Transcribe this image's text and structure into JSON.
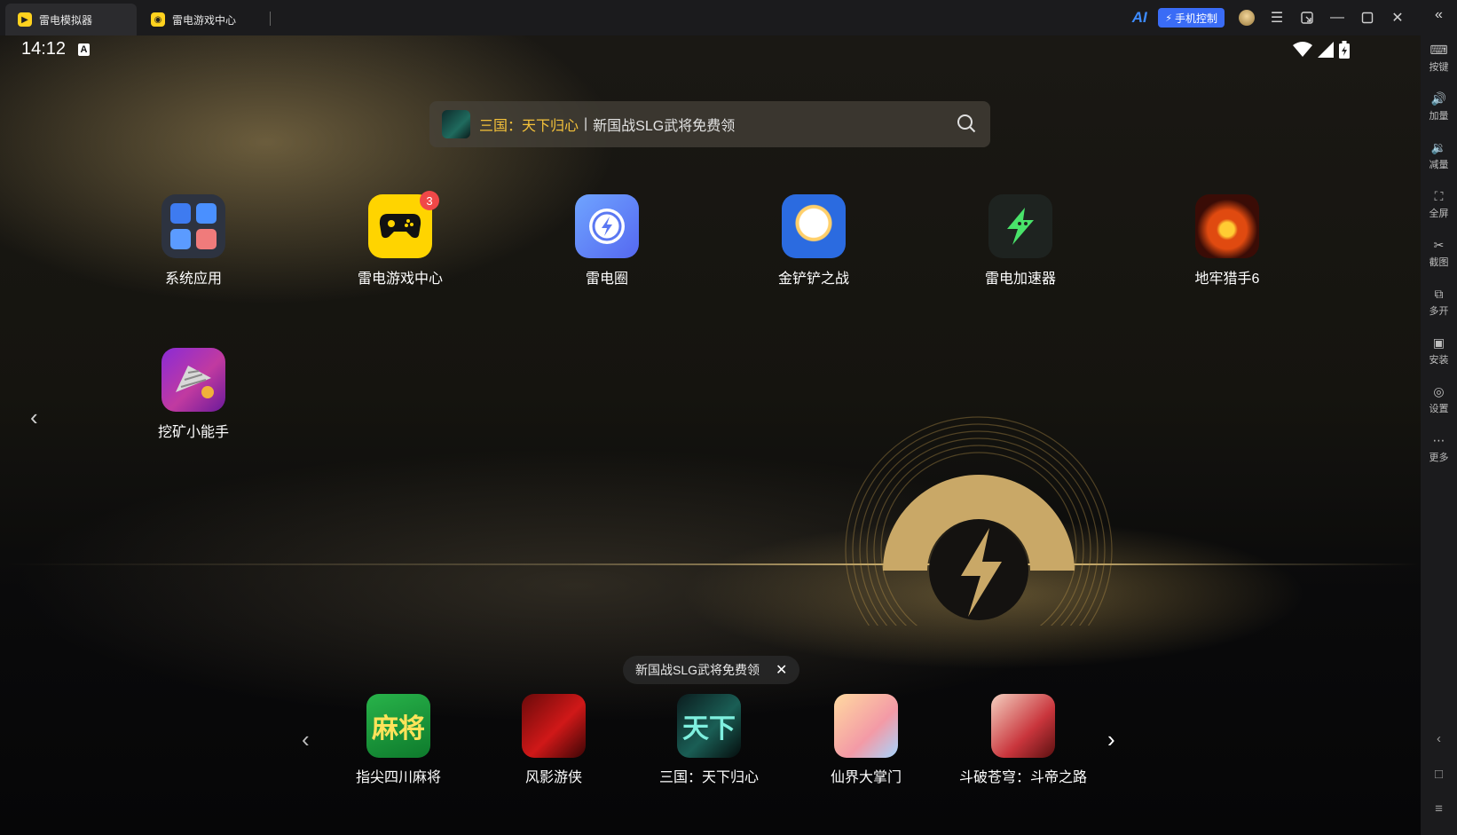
{
  "titlebar": {
    "tabs": [
      {
        "label": "雷电模拟器",
        "active": true
      },
      {
        "label": "雷电游戏中心",
        "active": false
      }
    ],
    "ai_label": "AI",
    "phone_control_label": "手机控制",
    "accent": "#3a6cf6"
  },
  "status": {
    "time": "14:12",
    "keyboard_indicator": "A"
  },
  "search": {
    "highlight": "三国：天下归心",
    "separator": "|",
    "text": "新国战SLG武将免费领"
  },
  "apps": [
    {
      "label": "系统应用",
      "icon": "system-apps-folder-icon"
    },
    {
      "label": "雷电游戏中心",
      "icon": "gamepad-icon",
      "badge": "3"
    },
    {
      "label": "雷电圈",
      "icon": "lightning-circle-icon"
    },
    {
      "label": "金铲铲之战",
      "icon": "game-penguin-icon"
    },
    {
      "label": "雷电加速器",
      "icon": "accelerator-icon"
    },
    {
      "label": "地牢猎手6",
      "icon": "game-dragon-icon"
    },
    {
      "label": "挖矿小能手",
      "icon": "game-drill-icon"
    }
  ],
  "promo": {
    "text": "新国战SLG武将免费领",
    "close": "✕"
  },
  "dock": {
    "prev": "‹",
    "next": "›",
    "items": [
      {
        "label": "指尖四川麻将",
        "icon_text": "麻将"
      },
      {
        "label": "风影游侠"
      },
      {
        "label": "三国：天下归心",
        "icon_text": "天下"
      },
      {
        "label": "仙界大掌门"
      },
      {
        "label": "斗破苍穹：斗帝之路"
      }
    ]
  },
  "sidebar": {
    "collapse": "«",
    "items": [
      {
        "label": "按键",
        "icon": "keyboard-icon",
        "glyph": "⌨"
      },
      {
        "label": "加量",
        "icon": "volume-up-icon",
        "glyph": "🔊"
      },
      {
        "label": "减量",
        "icon": "volume-down-icon",
        "glyph": "🔉"
      },
      {
        "label": "全屏",
        "icon": "fullscreen-icon",
        "glyph": "⛶"
      },
      {
        "label": "截图",
        "icon": "scissors-icon",
        "glyph": "✂"
      },
      {
        "label": "多开",
        "icon": "multi-instance-icon",
        "glyph": "⧉"
      },
      {
        "label": "安装",
        "icon": "apk-install-icon",
        "glyph": "▣"
      },
      {
        "label": "设置",
        "icon": "settings-icon",
        "glyph": "◎"
      },
      {
        "label": "更多",
        "icon": "more-icon",
        "glyph": "⋯"
      }
    ],
    "nav": {
      "back": "‹",
      "home": "□",
      "recents": "≡"
    }
  }
}
